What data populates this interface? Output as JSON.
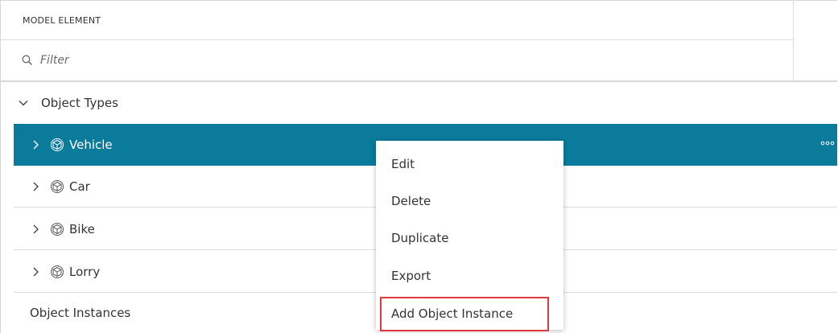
{
  "header": {
    "title": "MODEL ELEMENT"
  },
  "filter": {
    "placeholder": "Filter",
    "icon": "search-icon"
  },
  "tree": {
    "group_label": "Object Types",
    "items": [
      {
        "label": "Vehicle",
        "icon": "cube-icon",
        "selected": true
      },
      {
        "label": "Car",
        "icon": "cube-icon",
        "selected": false
      },
      {
        "label": "Bike",
        "icon": "cube-icon",
        "selected": false
      },
      {
        "label": "Lorry",
        "icon": "cube-icon",
        "selected": false
      }
    ],
    "instances_label": "Object Instances"
  },
  "context_menu": {
    "items": [
      "Edit",
      "Delete",
      "Duplicate",
      "Export",
      "Add Object Instance"
    ],
    "highlighted_item": "Add Object Instance"
  },
  "colors": {
    "selected_row": "#0b7b9c",
    "highlight_border": "#e0393e"
  }
}
